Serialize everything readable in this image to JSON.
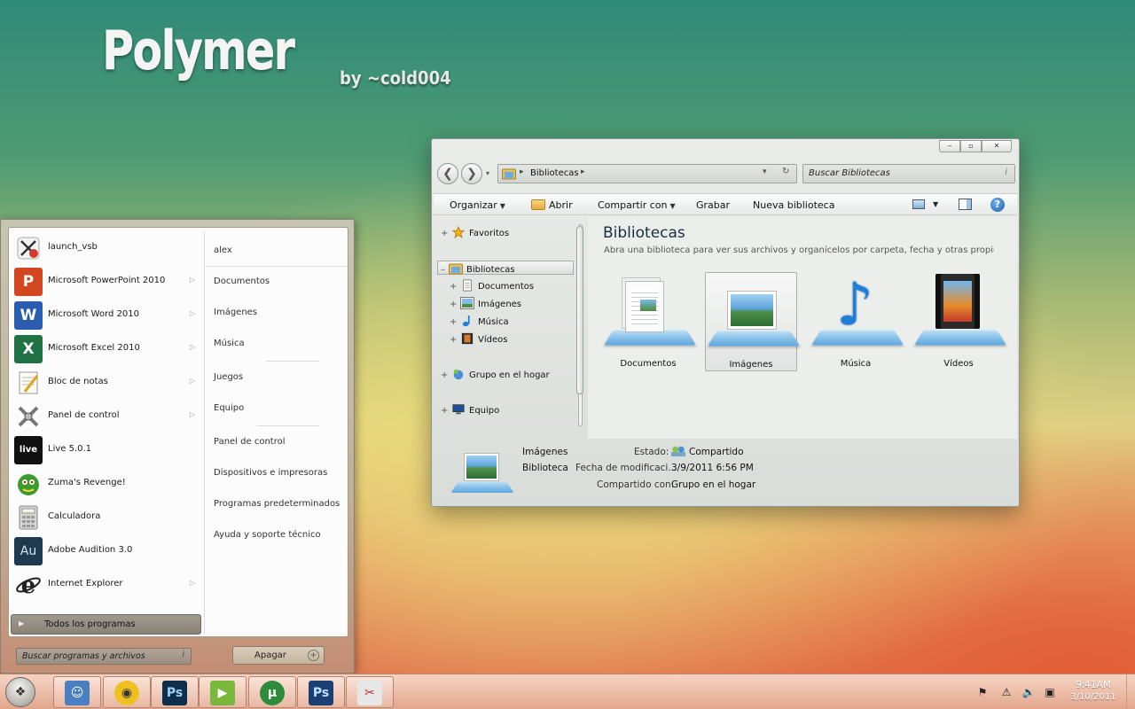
{
  "brand": {
    "title": "Polymer",
    "byline": "by ~cold004"
  },
  "explorer": {
    "nav": {
      "back": "❮",
      "forward": "❯",
      "recent": "▾"
    },
    "address": {
      "text": "Bibliotecas",
      "sep": "▸",
      "dropdown": "▾",
      "refresh": "↻"
    },
    "search": {
      "placeholder": "Buscar Bibliotecas",
      "icon_text": "i"
    },
    "commands": {
      "organizar": "Organizar",
      "abrir": "Abrir",
      "compartir": "Compartir con",
      "grabar": "Grabar",
      "nueva": "Nueva biblioteca",
      "help": "?"
    },
    "tree": {
      "favoritos": "Favoritos",
      "bibliotecas": "Bibliotecas",
      "documentos": "Documentos",
      "imagenes": "Imágenes",
      "musica": "Música",
      "videos": "Vídeos",
      "grupo": "Grupo en el hogar",
      "equipo": "Equipo",
      "expander_plus": "+",
      "expander_minus": "–"
    },
    "content": {
      "title": "Bibliotecas",
      "subtitle": "Abra una biblioteca para ver sus archivos y organícelos por carpeta, fecha y otras propied…",
      "libraries": [
        "Documentos",
        "Imágenes",
        "Música",
        "Vídeos"
      ]
    },
    "details": {
      "name": "Imágenes",
      "type": "Biblioteca",
      "estado_label": "Estado:",
      "estado_value": "Compartido",
      "fecha_label": "Fecha de modificaci...",
      "fecha_value": "3/9/2011 6:56 PM",
      "compartido_label": "Compartido con:",
      "compartido_value": "Grupo en el hogar"
    },
    "window_buttons": {
      "minimize": "‒",
      "maximize": "▫",
      "close": "✕"
    }
  },
  "startmenu": {
    "programs": [
      {
        "label": "launch_vsb",
        "icon": "launch-vsb-icon",
        "arrow": false
      },
      {
        "label": "Microsoft PowerPoint 2010",
        "icon": "powerpoint-icon",
        "glyph": "P",
        "color": "#d2471f",
        "arrow": true
      },
      {
        "label": "Microsoft Word 2010",
        "icon": "word-icon",
        "glyph": "W",
        "color": "#2a5db0",
        "arrow": true
      },
      {
        "label": "Microsoft Excel 2010",
        "icon": "excel-icon",
        "glyph": "X",
        "color": "#207245",
        "arrow": true
      },
      {
        "label": "Bloc de notas",
        "icon": "notepad-icon",
        "arrow": true
      },
      {
        "label": "Panel de control",
        "icon": "control-panel-icon",
        "arrow": true
      },
      {
        "label": "Live 5.0.1",
        "icon": "live-icon",
        "glyph": "live",
        "color": "#111111",
        "arrow": false
      },
      {
        "label": "Zuma's Revenge!",
        "icon": "zuma-icon",
        "arrow": false
      },
      {
        "label": "Calculadora",
        "icon": "calculator-icon",
        "arrow": false
      },
      {
        "label": "Adobe Audition 3.0",
        "icon": "audition-icon",
        "glyph": "Au",
        "color": "#1d3a4f",
        "arrow": false
      },
      {
        "label": "Internet Explorer",
        "icon": "internet-explorer-icon",
        "glyph": "e",
        "color": "#ffffff",
        "arrow": true
      }
    ],
    "links": {
      "user": "alex",
      "documentos": "Documentos",
      "imagenes": "Imágenes",
      "musica": "Música",
      "juegos": "Juegos",
      "equipo": "Equipo",
      "panel": "Panel de control",
      "dispositivos": "Dispositivos e impresoras",
      "programas": "Programas predeterminados",
      "ayuda": "Ayuda y soporte técnico"
    },
    "all_programs": "Todos los programas",
    "search_placeholder": "Buscar programas y archivos",
    "search_icon_text": "i",
    "shutdown": "Apagar",
    "submenu_arrow": "▷"
  },
  "taskbar": {
    "start_glyph": "❖",
    "apps": [
      {
        "name": "finder-icon",
        "glyph": "☺",
        "color": "#4a7fc1"
      },
      {
        "name": "chrome-icon",
        "glyph": "◉",
        "color": "#e8a800"
      },
      {
        "name": "photoshop-icon",
        "glyph": "Ps",
        "color": "#0e2f4c"
      },
      {
        "name": "media-player-icon",
        "glyph": "▶",
        "color": "#79b83c"
      },
      {
        "name": "utorrent-icon",
        "glyph": "µ",
        "color": "#2e8b3a"
      },
      {
        "name": "photoshop-cs5-icon",
        "glyph": "Ps",
        "color": "#1b3f73"
      },
      {
        "name": "launch-vsb-icon",
        "glyph": "✂",
        "color": "#e7e7e7"
      }
    ],
    "tray": [
      "⚑",
      "⚠",
      "🔈",
      "▣"
    ],
    "clock_time": "9:41AM",
    "clock_date": "3/10/2011"
  }
}
